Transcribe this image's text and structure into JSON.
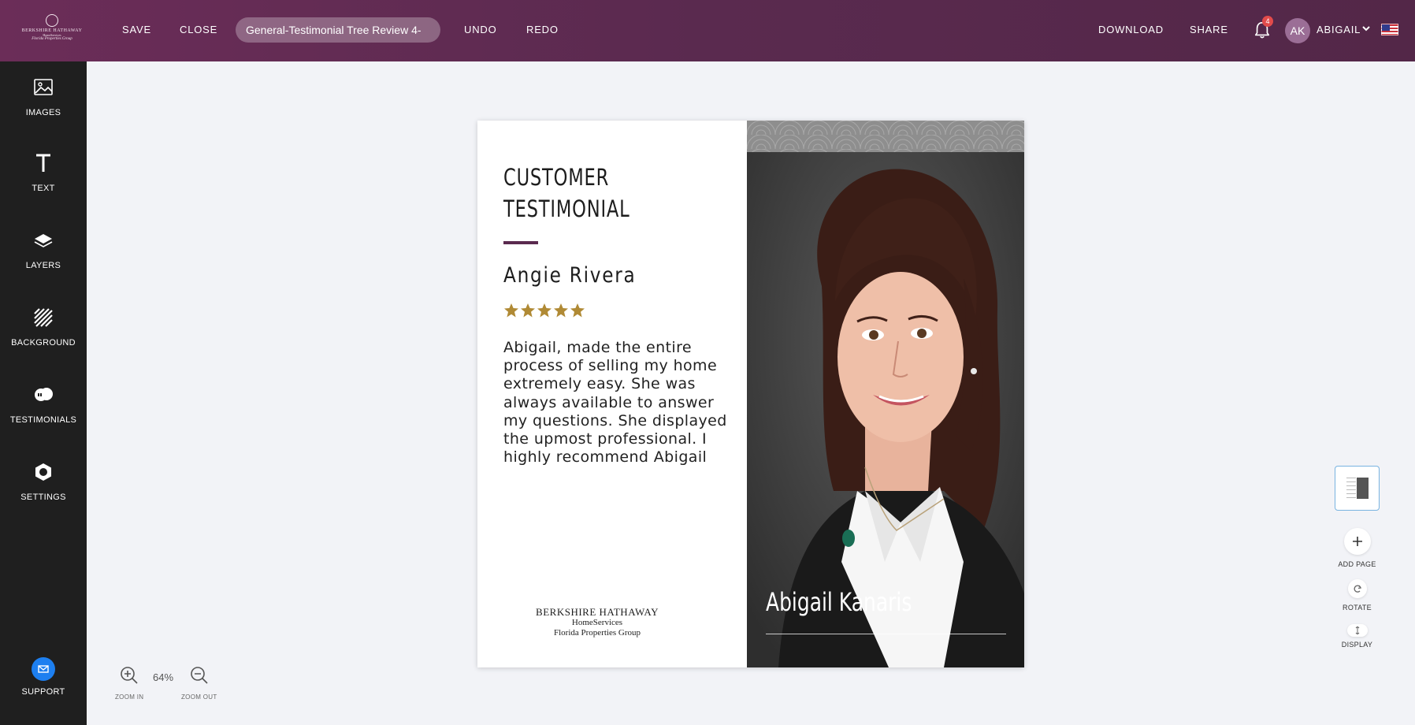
{
  "header": {
    "logo": {
      "line1": "BERKSHIRE HATHAWAY",
      "line2": "HomeServices",
      "line3": "Florida Properties Group"
    },
    "save_label": "SAVE",
    "close_label": "CLOSE",
    "document_title": "General-Testimonial Tree Review 4-",
    "undo_label": "UNDO",
    "redo_label": "REDO",
    "download_label": "DOWNLOAD",
    "share_label": "SHARE",
    "notification_count": "4",
    "user_initials": "AK",
    "user_name": "ABIGAIL"
  },
  "sidebar": {
    "items": [
      {
        "label": "IMAGES",
        "icon": "image-icon"
      },
      {
        "label": "TEXT",
        "icon": "text-icon"
      },
      {
        "label": "LAYERS",
        "icon": "layers-icon"
      },
      {
        "label": "BACKGROUND",
        "icon": "background-icon"
      },
      {
        "label": "TESTIMONIALS",
        "icon": "testimonials-icon"
      },
      {
        "label": "SETTINGS",
        "icon": "settings-icon"
      }
    ],
    "support_label": "SUPPORT"
  },
  "zoom": {
    "zoom_in_label": "ZOOM IN",
    "zoom_out_label": "ZOOM OUT",
    "level": "64%"
  },
  "canvas": {
    "heading_line1": "CUSTOMER",
    "heading_line2": "TESTIMONIAL",
    "customer_name": "Angie Rivera",
    "rating": 5,
    "review_text": "Abigail, made the entire process of selling my home extremely easy. She was always available to answer my questions. She displayed the upmost professional. I highly recommend Abigail",
    "brand": {
      "line1": "BERKSHIRE HATHAWAY",
      "line2": "HomeServices",
      "line3": "Florida Properties Group"
    },
    "agent_name": "Abigail Kanaris"
  },
  "tools": {
    "add_page_label": "ADD PAGE",
    "rotate_label": "ROTATE",
    "display_label": "DISPLAY"
  },
  "colors": {
    "header_bg": "#6b2d58",
    "sidebar_bg": "#1f1f1f",
    "accent": "#5a2a4f",
    "star": "#b08a35",
    "support_blue": "#1d7ff0",
    "badge_red": "#e24b4b"
  }
}
